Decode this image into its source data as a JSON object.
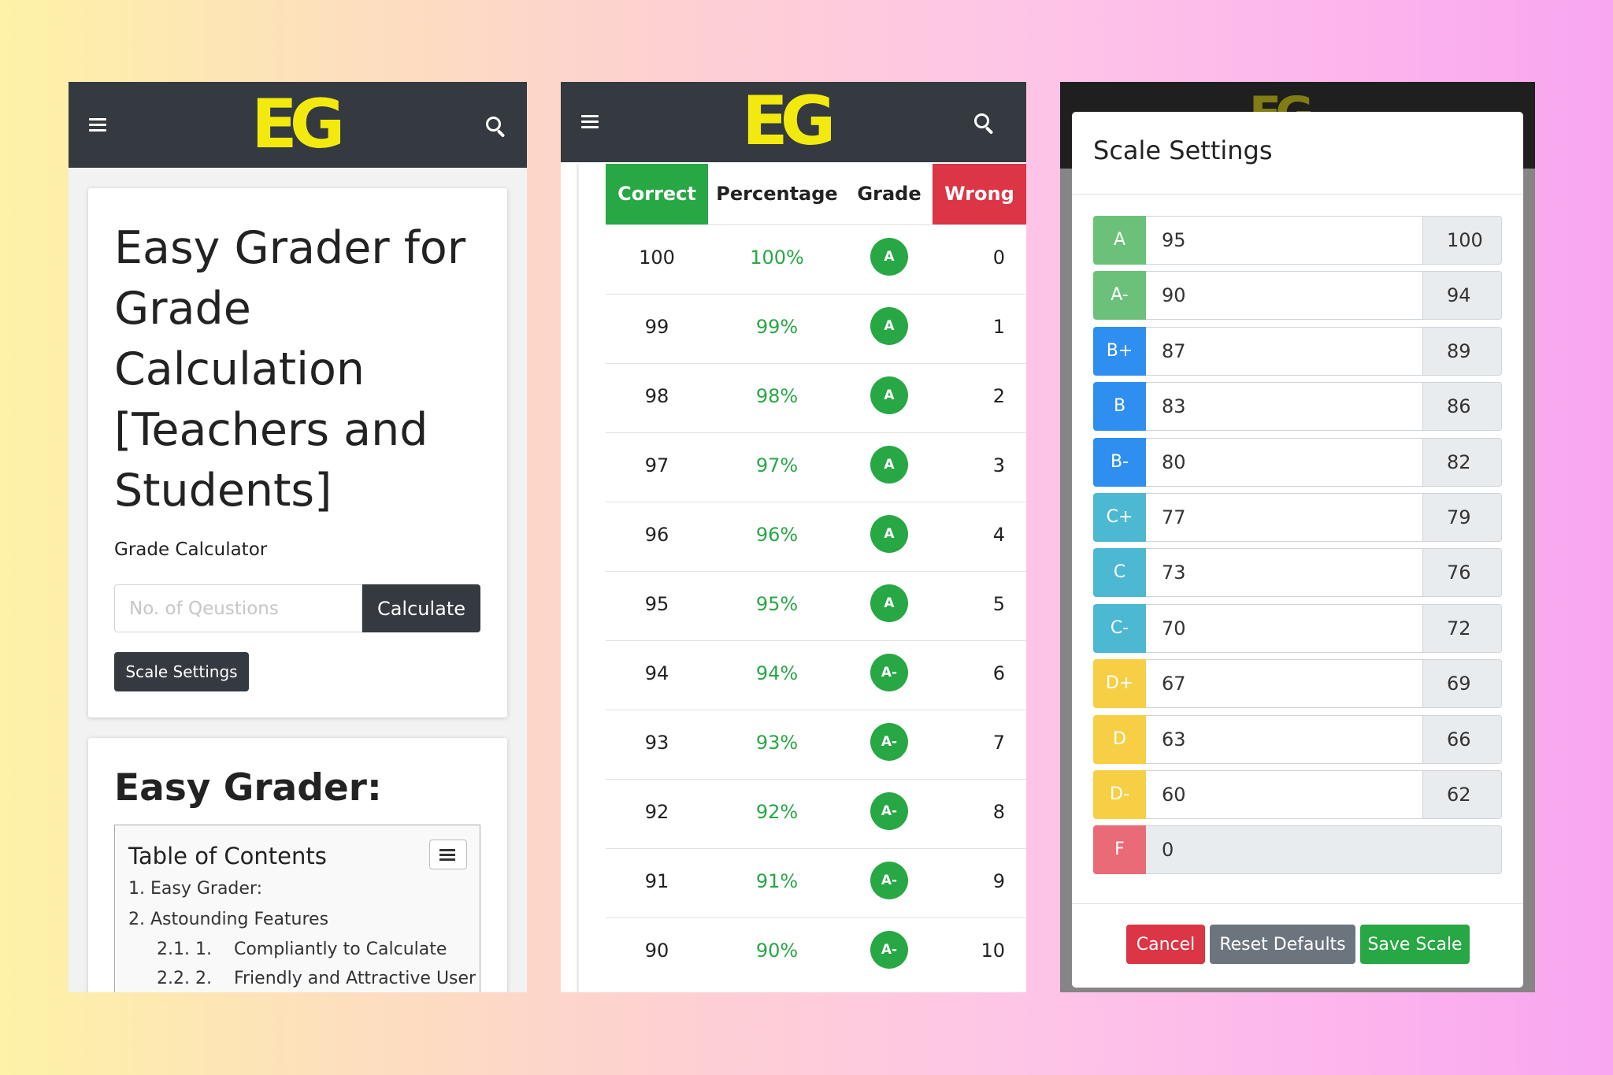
{
  "colors": {
    "navbar": "#343a40",
    "logo_yellow": "#f2ea0f",
    "success": "#28a745",
    "danger": "#dc3545",
    "secondary": "#6c757d",
    "grade_a": "#6cc17a",
    "grade_b": "#2f8ff0",
    "grade_c": "#4db8d2",
    "grade_d": "#f7cf45",
    "grade_f": "#ea6b78"
  },
  "logo": {
    "text": "EG"
  },
  "panel1": {
    "title": "Easy Grader for Grade Calculation [Teachers and Students]",
    "calculator_label": "Grade Calculator",
    "questions_placeholder": "No. of Qeustions",
    "calculate_label": "Calculate",
    "scale_settings_label": "Scale Settings",
    "article_heading": "Easy Grader:",
    "toc": {
      "title": "Table of Contents",
      "items": [
        {
          "num": "1.",
          "label": "Easy Grader:"
        },
        {
          "num": "2.",
          "label": "Astounding Features"
        },
        {
          "num": "2.1. 1.",
          "label": "Compliantly to Calculate"
        },
        {
          "num": "2.2. 2.",
          "label": "Friendly and Attractive User"
        }
      ]
    }
  },
  "panel2": {
    "headers": {
      "correct": "Correct",
      "percentage": "Percentage",
      "grade": "Grade",
      "wrong": "Wrong"
    },
    "rows": [
      {
        "correct": "100",
        "percentage": "100%",
        "grade": "A",
        "wrong": "0"
      },
      {
        "correct": "99",
        "percentage": "99%",
        "grade": "A",
        "wrong": "1"
      },
      {
        "correct": "98",
        "percentage": "98%",
        "grade": "A",
        "wrong": "2"
      },
      {
        "correct": "97",
        "percentage": "97%",
        "grade": "A",
        "wrong": "3"
      },
      {
        "correct": "96",
        "percentage": "96%",
        "grade": "A",
        "wrong": "4"
      },
      {
        "correct": "95",
        "percentage": "95%",
        "grade": "A",
        "wrong": "5"
      },
      {
        "correct": "94",
        "percentage": "94%",
        "grade": "A-",
        "wrong": "6"
      },
      {
        "correct": "93",
        "percentage": "93%",
        "grade": "A-",
        "wrong": "7"
      },
      {
        "correct": "92",
        "percentage": "92%",
        "grade": "A-",
        "wrong": "8"
      },
      {
        "correct": "91",
        "percentage": "91%",
        "grade": "A-",
        "wrong": "9"
      },
      {
        "correct": "90",
        "percentage": "90%",
        "grade": "A-",
        "wrong": "10"
      }
    ]
  },
  "panel3": {
    "modal_title": "Scale Settings",
    "scale": [
      {
        "grade": "A",
        "min": "95",
        "max": "100",
        "color": "#6cc17a"
      },
      {
        "grade": "A-",
        "min": "90",
        "max": "94",
        "color": "#6cc17a"
      },
      {
        "grade": "B+",
        "min": "87",
        "max": "89",
        "color": "#2f8ff0"
      },
      {
        "grade": "B",
        "min": "83",
        "max": "86",
        "color": "#2f8ff0"
      },
      {
        "grade": "B-",
        "min": "80",
        "max": "82",
        "color": "#2f8ff0"
      },
      {
        "grade": "C+",
        "min": "77",
        "max": "79",
        "color": "#4db8d2"
      },
      {
        "grade": "C",
        "min": "73",
        "max": "76",
        "color": "#4db8d2"
      },
      {
        "grade": "C-",
        "min": "70",
        "max": "72",
        "color": "#4db8d2"
      },
      {
        "grade": "D+",
        "min": "67",
        "max": "69",
        "color": "#f7cf45"
      },
      {
        "grade": "D",
        "min": "63",
        "max": "66",
        "color": "#f7cf45"
      },
      {
        "grade": "D-",
        "min": "60",
        "max": "62",
        "color": "#f7cf45"
      },
      {
        "grade": "F",
        "min": "0",
        "max": null,
        "color": "#ea6b78"
      }
    ],
    "cancel_label": "Cancel",
    "reset_label": "Reset Defaults",
    "save_label": "Save Scale"
  }
}
